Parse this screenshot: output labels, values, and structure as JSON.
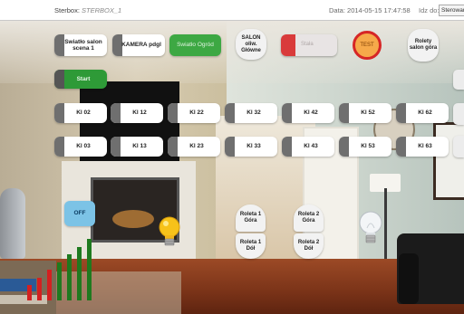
{
  "topbar": {
    "app_label": "Sterbox:",
    "app_name": "STERBOX_1",
    "date_label": "Data:",
    "date_value": "2014-05-15 17:47:58",
    "id_label": "Idz do:",
    "id_select_value": "Sterowan"
  },
  "tiles": {
    "swiatlo_salon_scena": "Swiatło salon scena 1",
    "kamera_pdgl": "KAMERA pdgl",
    "swiatlo_ogrod": "Swiatło Ogród",
    "salon_oliw_glowne": "SALON oliw. Główne",
    "red_toggle": "Stała",
    "test": "TEST",
    "rolety_salon_gora": "Rolety salon góra",
    "start": "Start",
    "off": "OFF",
    "rolety_1_gora": "Roleta 1 Góra",
    "rolety_1_dol": "Roleta 1 Dół",
    "rolety_2_gora": "Roleta 2 Góra",
    "rolety_2_dol": "Roleta 2 Dół"
  },
  "row1": [
    "Kl 02",
    "Kl 12",
    "Kl 22",
    "Kl 32",
    "Kl 42",
    "Kl 52",
    "Kl 62"
  ],
  "row2": [
    "Kl 03",
    "Kl 13",
    "Kl 23",
    "Kl 33",
    "Kl 43",
    "Kl 53",
    "Kl 63"
  ],
  "signal_bars": [
    2,
    3,
    4,
    5,
    6,
    7,
    8
  ],
  "colors": {
    "green": "#3da843",
    "red": "#d93b3b",
    "test_orange": "#f6a94a",
    "off_blue": "#7cc3e6",
    "bar_red": "#d42020",
    "bar_green": "#1f7a1f"
  }
}
